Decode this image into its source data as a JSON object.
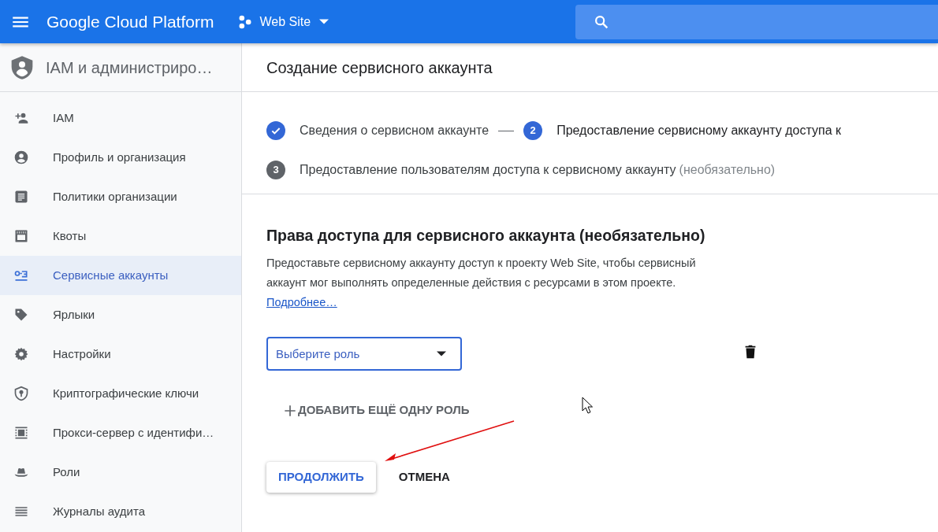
{
  "topbar": {
    "title": "Google Cloud Platform",
    "project": "Web Site"
  },
  "sidebar": {
    "title": "IAM и администриро…",
    "items": [
      {
        "label": "IAM",
        "selected": false
      },
      {
        "label": "Профиль и организация",
        "selected": false
      },
      {
        "label": "Политики организации",
        "selected": false
      },
      {
        "label": "Квоты",
        "selected": false
      },
      {
        "label": "Сервисные аккаунты",
        "selected": true
      },
      {
        "label": "Ярлыки",
        "selected": false
      },
      {
        "label": "Настройки",
        "selected": false
      },
      {
        "label": "Криптографические ключи",
        "selected": false
      },
      {
        "label": "Прокси-сервер с идентифи…",
        "selected": false
      },
      {
        "label": "Роли",
        "selected": false
      },
      {
        "label": "Журналы аудита",
        "selected": false
      }
    ]
  },
  "page_title": "Создание сервисного аккаунта",
  "steps": [
    {
      "completed": true,
      "label": "Сведения о сервисном аккаунте"
    },
    {
      "completed": false,
      "active": true,
      "number": "2",
      "label": "Предоставление сервисному аккаунту доступа к"
    },
    {
      "completed": false,
      "active": false,
      "number": "3",
      "label": "Предоставление пользователям доступа к сервисному аккаунту",
      "note": "(необязательно)"
    }
  ],
  "section": {
    "title": "Права доступа для сервисного аккаунта (необязательно)",
    "description": "Предоставьте сервисному аккаунту доступ к проекту Web Site, чтобы сервисный аккаунт мог выполнять определенные действия с ресурсами в этом проекте.",
    "link": "Подробнее…",
    "role_select": {
      "placeholder": "Выберите роль"
    },
    "add_role": "ДОБАВИТЬ ЕЩЁ ОДНУ РОЛЬ",
    "buttons": [
      {
        "label": "ПРОДОЛЖИТЬ",
        "kind": "raised"
      },
      {
        "label": "ОТМЕНА",
        "kind": "flat"
      }
    ]
  }
}
